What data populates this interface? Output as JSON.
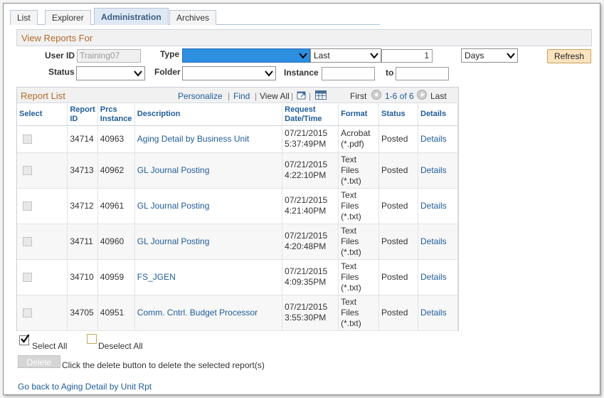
{
  "tabs": [
    "List",
    "Explorer",
    "Administration",
    "Archives"
  ],
  "filters": {
    "section_title": "View Reports For",
    "user_id_label": "User ID",
    "user_id_value": "Training07",
    "type_label": "Type",
    "type_value": "",
    "last_value": "Last",
    "number_value": "1",
    "unit_value": "Days",
    "refresh_label": "Refresh",
    "status_label": "Status",
    "status_value": "",
    "folder_label": "Folder",
    "folder_value": "",
    "instance_label": "Instance",
    "instance_from": "",
    "to_label": "to",
    "instance_to": ""
  },
  "grid": {
    "title": "Report List",
    "personalize": "Personalize",
    "find": "Find",
    "view_all": "View All",
    "first": "First",
    "range": "1-6 of 6",
    "last": "Last",
    "columns": {
      "select": "Select",
      "report_id": "Report ID",
      "prcs_instance": "Prcs Instance",
      "description": "Description",
      "request": "Request Date/Time",
      "format": "Format",
      "status": "Status",
      "details": "Details"
    },
    "rows": [
      {
        "report_id": "34714",
        "instance": "40963",
        "description": "Aging Detail by Business Unit",
        "date": "07/21/2015",
        "time": "5:37:49PM",
        "format": "Acrobat (*.pdf)",
        "status": "Posted",
        "details": "Details"
      },
      {
        "report_id": "34713",
        "instance": "40962",
        "description": "GL Journal Posting",
        "date": "07/21/2015",
        "time": "4:22:10PM",
        "format": "Text Files (*.txt)",
        "status": "Posted",
        "details": "Details"
      },
      {
        "report_id": "34712",
        "instance": "40961",
        "description": "GL Journal Posting",
        "date": "07/21/2015",
        "time": "4:21:40PM",
        "format": "Text Files (*.txt)",
        "status": "Posted",
        "details": "Details"
      },
      {
        "report_id": "34711",
        "instance": "40960",
        "description": "GL Journal Posting",
        "date": "07/21/2015",
        "time": "4:20:48PM",
        "format": "Text Files (*.txt)",
        "status": "Posted",
        "details": "Details"
      },
      {
        "report_id": "34710",
        "instance": "40959",
        "description": "FS_JGEN",
        "date": "07/21/2015",
        "time": "4:09:35PM",
        "format": "Text Files (*.txt)",
        "status": "Posted",
        "details": "Details"
      },
      {
        "report_id": "34705",
        "instance": "40951",
        "description": "Comm. Cntrl. Budget Processor",
        "date": "07/21/2015",
        "time": "3:55:30PM",
        "format": "Text Files (*.txt)",
        "status": "Posted",
        "details": "Details"
      }
    ]
  },
  "actions": {
    "select_all": "Select All",
    "deselect_all": "Deselect All",
    "delete_label": "Delete",
    "delete_hint": "Click the delete button to delete the selected report(s)",
    "back_link": "Go back to Aging Detail by Unit Rpt"
  }
}
